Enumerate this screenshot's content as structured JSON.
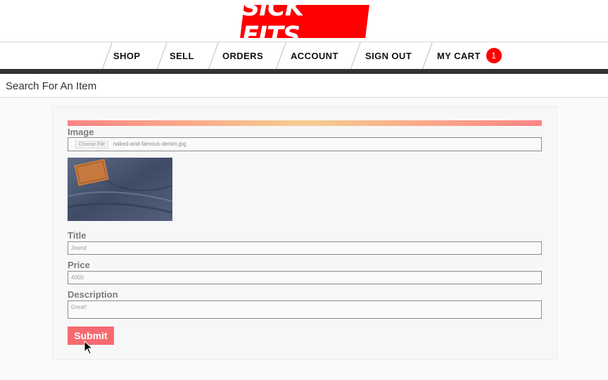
{
  "header": {
    "logo_text": "SICK FITS",
    "brand_color": "#ff0000"
  },
  "nav": {
    "items": [
      {
        "label": "SHOP"
      },
      {
        "label": "SELL"
      },
      {
        "label": "ORDERS"
      },
      {
        "label": "ACCOUNT"
      },
      {
        "label": "SIGN OUT"
      },
      {
        "label": "MY CART"
      }
    ],
    "cart_count": "1"
  },
  "search": {
    "placeholder": "Search For An Item"
  },
  "form": {
    "image_label": "Image",
    "file_button_label": "Choose File",
    "file_name": "naked-and-famous-denim.jpg",
    "title_label": "Title",
    "title_value": "Jeand",
    "price_label": "Price",
    "price_value": "4000",
    "description_label": "Description",
    "description_value": "Great!",
    "submit_label": "Submit",
    "submit_color": "#f46a6f"
  }
}
